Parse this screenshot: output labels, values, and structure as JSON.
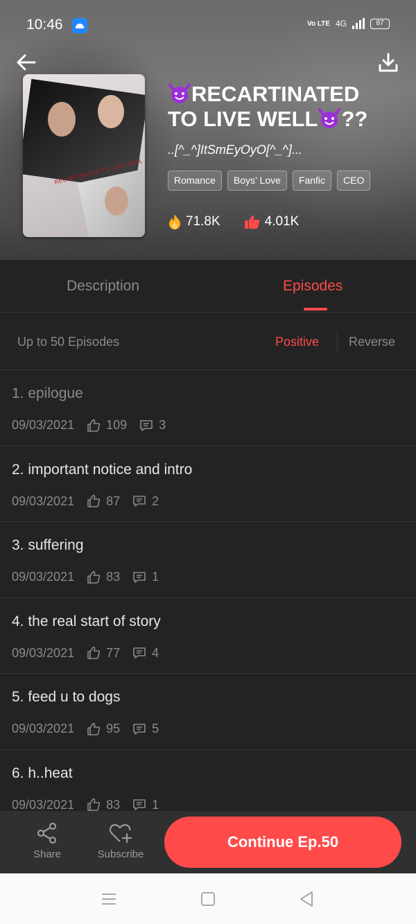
{
  "status_bar": {
    "time": "10:46",
    "network": "4G",
    "volte": "Vo LTE",
    "battery": "87"
  },
  "book": {
    "title": "😈RECARTINATED TO LIVE WELL😈??",
    "title_line1": "RECARTINATED",
    "title_line2": "TO LIVE WELL",
    "title_suffix": "??",
    "author": "..[^_^]ItSmEyOyO[^_^]...",
    "cover_text": "RECARTINATED TO LIVE WELL",
    "tags": [
      "Romance",
      "Boys’ Love",
      "Fanfic",
      "CEO"
    ],
    "views": "71.8K",
    "likes": "4.01K"
  },
  "tabs": {
    "description": "Description",
    "episodes": "Episodes",
    "active": "Episodes"
  },
  "sort": {
    "count_label": "Up to 50 Episodes",
    "positive": "Positive",
    "reverse": "Reverse",
    "active": "Positive"
  },
  "episodes": [
    {
      "title": "1. epilogue",
      "date": "09/03/2021",
      "likes": "109",
      "comments": "3",
      "read": true
    },
    {
      "title": "2. important notice and intro",
      "date": "09/03/2021",
      "likes": "87",
      "comments": "2",
      "read": false
    },
    {
      "title": "3. suffering",
      "date": "09/03/2021",
      "likes": "83",
      "comments": "1",
      "read": false
    },
    {
      "title": "4. the real start of story",
      "date": "09/03/2021",
      "likes": "77",
      "comments": "4",
      "read": false
    },
    {
      "title": "5. feed u to dogs",
      "date": "09/03/2021",
      "likes": "95",
      "comments": "5",
      "read": false
    },
    {
      "title": "6. h..heat",
      "date": "09/03/2021",
      "likes": "83",
      "comments": "1",
      "read": false
    }
  ],
  "bottom_bar": {
    "share": "Share",
    "subscribe": "Subscribe",
    "continue": "Continue Ep.50"
  },
  "colors": {
    "accent": "#ff4a4a",
    "background": "#232323",
    "muted": "#8a8a8a"
  }
}
